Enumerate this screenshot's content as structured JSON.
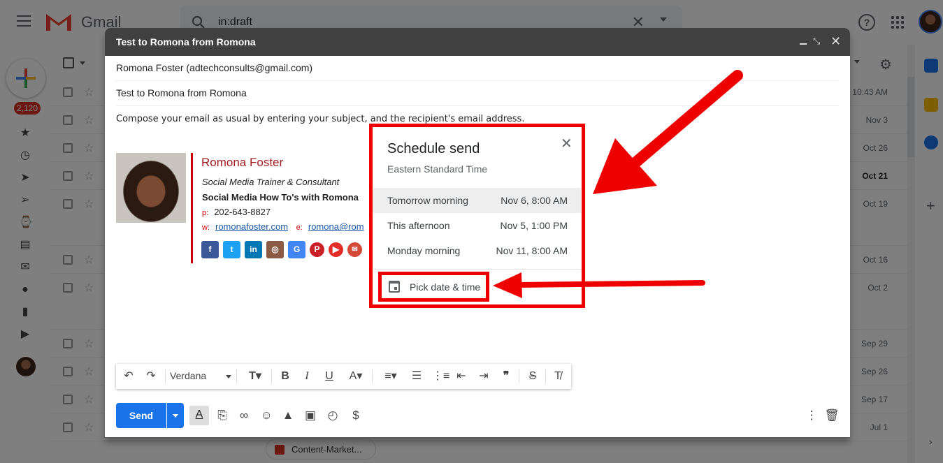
{
  "app": {
    "name": "Gmail"
  },
  "search": {
    "query": "in:draft"
  },
  "nav": {
    "inbox_count": "2,120"
  },
  "mail_list": {
    "dates": [
      "10:43 AM",
      "Nov 3",
      "Oct 26",
      "Oct 21",
      "Oct 19",
      "Oct 16",
      "Oct 2",
      "Sep 29",
      "Sep 26",
      "Sep 17",
      "Jul 1"
    ],
    "attachment_chip": "Content-Market..."
  },
  "compose": {
    "title": "Test to Romona from Romona",
    "from": "Romona Foster (adtechconsults@gmail.com)",
    "subject": "Test to Romona from Romona",
    "body": "Compose your email as usual by entering your subject, and the recipient's email address.",
    "send_label": "Send",
    "font_name": "Verdana"
  },
  "signature": {
    "name": "Romona Foster",
    "role": "Social Media Trainer & Consultant",
    "company": "Social Media How To's with Romona",
    "phone_label": "p:",
    "phone": "202-643-8827",
    "web_label": "w:",
    "website": "romonafoster.com",
    "email_label": "e:",
    "email": "romona@rom"
  },
  "schedule": {
    "title": "Schedule send",
    "timezone": "Eastern Standard Time",
    "options": [
      {
        "label": "Tomorrow morning",
        "time": "Nov 6, 8:00 AM"
      },
      {
        "label": "This afternoon",
        "time": "Nov 5, 1:00 PM"
      },
      {
        "label": "Monday morning",
        "time": "Nov 11, 8:00 AM"
      }
    ],
    "pick_label": "Pick date & time"
  },
  "colors": {
    "annotation_red": "#ee0000",
    "send_blue": "#1a73e8",
    "compose_header": "#404040",
    "signature_red": "#a21d21"
  }
}
